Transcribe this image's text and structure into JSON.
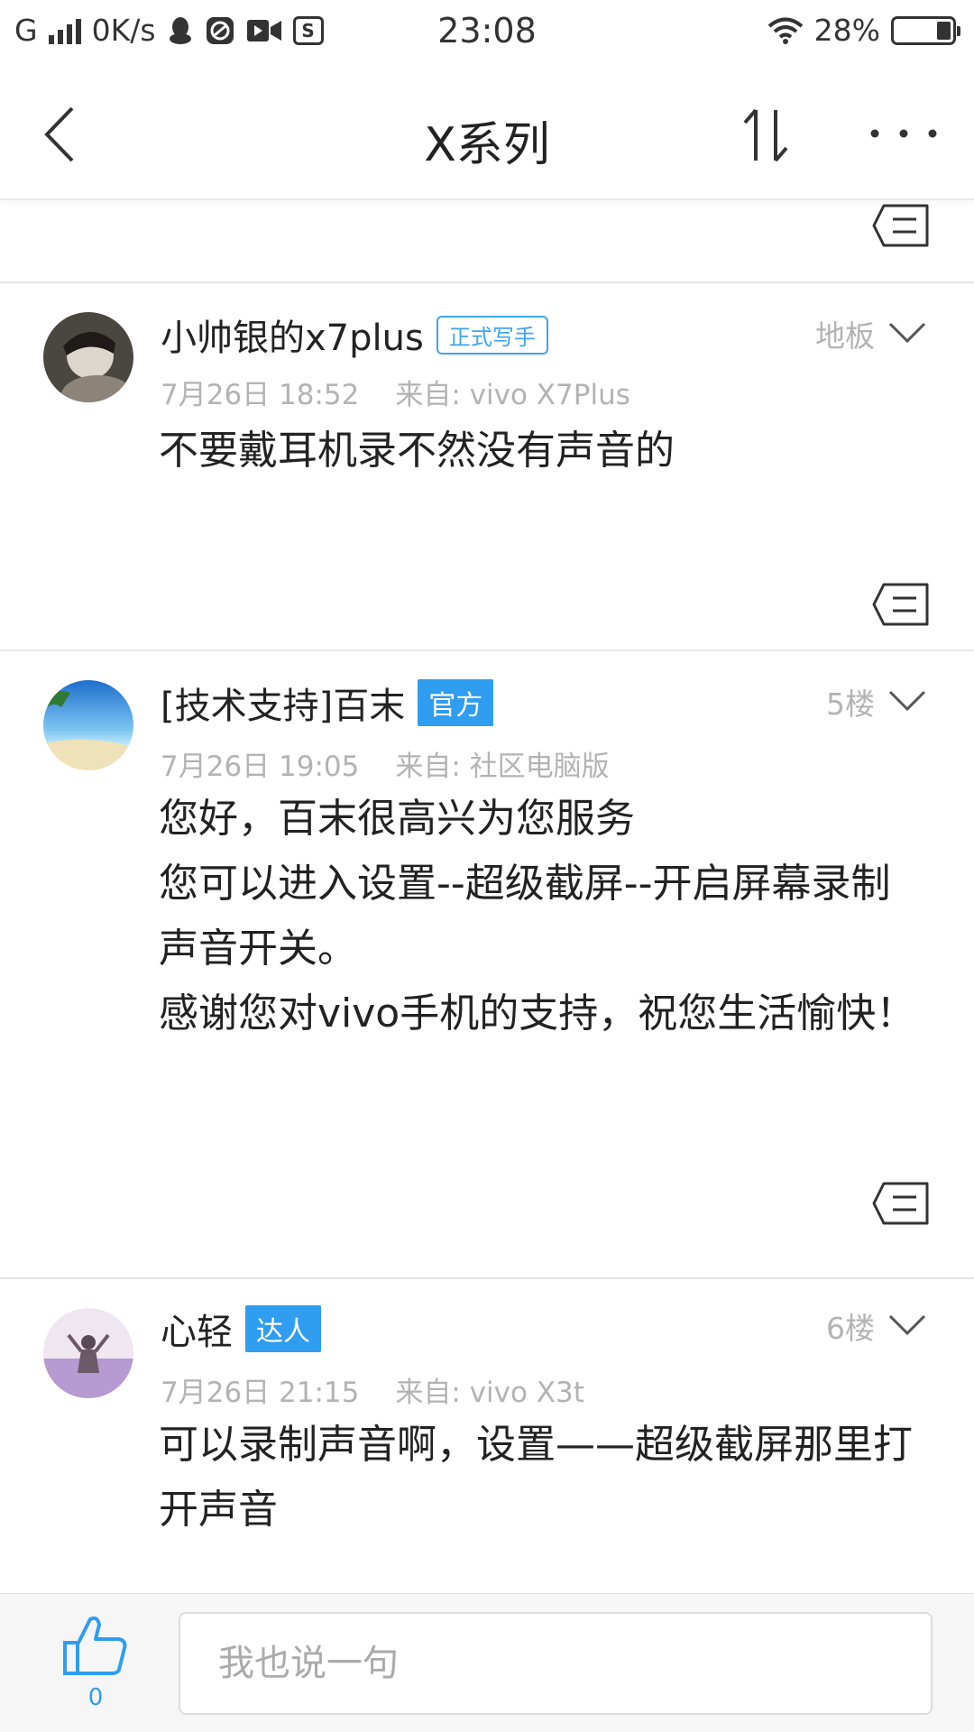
{
  "status_bar": {
    "network": "G",
    "speed": "0K/s",
    "sim_letter": "S",
    "time": "23:08",
    "battery": "28%",
    "battery_level": 0.28,
    "icons": [
      "signal-icon",
      "qq-icon",
      "gallery-icon",
      "video-icon",
      "sim-icon",
      "wifi-icon",
      "battery-icon"
    ]
  },
  "header": {
    "title": "X系列",
    "icons": [
      "back-arrow-icon",
      "sort-icon",
      "more-icon"
    ]
  },
  "posts": [
    {
      "username": "小帅银的x7plus",
      "badge": "正式写手",
      "time": "7月26日 18:52",
      "source": "来自: vivo X7Plus",
      "floor": "地板",
      "content": [
        "不要戴耳机录不然没有声音的"
      ]
    },
    {
      "username": "[技术支持]百末",
      "badge": "官方",
      "time": "7月26日 19:05",
      "source": "来自: 社区电脑版",
      "floor": "5楼",
      "content": [
        "您好，百末很高兴为您服务",
        "您可以进入设置--超级截屏--开启屏幕录制声音开关。",
        "感谢您对vivo手机的支持，祝您生活愉快！"
      ]
    },
    {
      "username": "心轻",
      "badge": "达人",
      "time": "7月26日 21:15",
      "source": "来自: vivo X3t",
      "floor": "6楼",
      "content": [
        "可以录制声音啊，设置——超级截屏那里打开声音"
      ]
    }
  ],
  "bottom_bar": {
    "like_count": "0",
    "input_placeholder": "我也说一句"
  },
  "colors": {
    "accent": "#2f9df0",
    "meta_text": "#b3b3b3",
    "divider": "#e6e6e6"
  }
}
